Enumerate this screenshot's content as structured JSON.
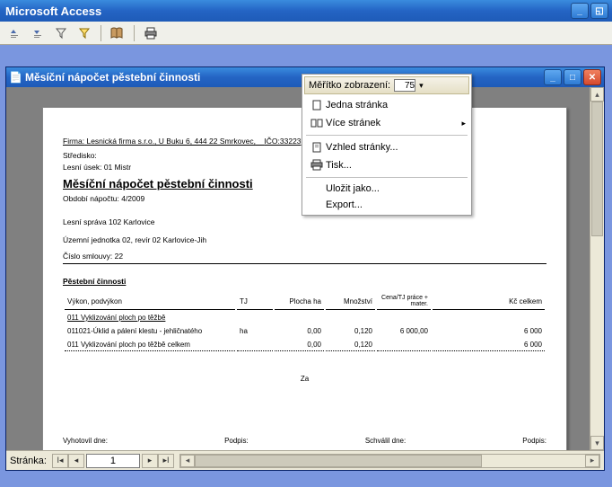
{
  "app": {
    "title": "Microsoft Access"
  },
  "docwin": {
    "title": "Měsíční nápočet pěstební činnosti"
  },
  "report": {
    "firm_label": "Firma:",
    "firm": "Lesnická firma s.r.o., U Buku 6, 444 22 Smrkovec,",
    "ico_label": "IČO:33223",
    "stredisko_label": "Středisko:",
    "lesni_usek": "Lesní úsek: 01 Mistr",
    "title": "Měsíční nápočet pěstební činnosti",
    "obdobi": "Období nápočtu:  4/2009",
    "sprava": "Lesní správa 102 Karlovice",
    "jednotka": "Územní jednotka 02, revír 02 Karlovice-Jih",
    "smlouva": "Číslo smlouvy:   22",
    "section": "Pěstební činnosti",
    "headers": {
      "vykon": "Výkon, podvýkon",
      "tj": "TJ",
      "plocha": "Plocha ha",
      "mnozstvi": "Množství",
      "cena": "Cena/TJ práce + mater.",
      "kc": "Kč celkem"
    },
    "rows": [
      {
        "label": "011  Vyklizování ploch po těžbě",
        "sub": true
      },
      {
        "label": "011021-Úklid a pálení klestu - jehličnatého",
        "tj": "ha",
        "plocha": "0,00",
        "mnoz": "0,120",
        "cena": "6 000,00",
        "kc": "6 000"
      },
      {
        "label": "011 Vyklizování ploch po těžbě celkem",
        "tj": "",
        "plocha": "0,00",
        "mnoz": "0,120",
        "cena": "",
        "kc": "6 000",
        "dot": true
      }
    ],
    "za": "Za",
    "sign": {
      "vyhotovil": "Vyhotovil dne:",
      "podpis": "Podpis:",
      "schvalil": "Schválil dne:",
      "podpis2": "Podpis:"
    }
  },
  "footer": {
    "page_label": "Stránka:",
    "page": "1"
  },
  "menu": {
    "scale_label": "Měřítko zobrazení:",
    "scale_value": "75",
    "items": [
      {
        "key": "one_page",
        "label": "Jedna stránka"
      },
      {
        "key": "more_pages",
        "label": "Více stránek",
        "arrow": true
      },
      {
        "key": "page_setup",
        "label": "Vzhled stránky..."
      },
      {
        "key": "print",
        "label": "Tisk..."
      },
      {
        "key": "save_as",
        "label": "Uložit jako..."
      },
      {
        "key": "export",
        "label": "Export..."
      }
    ]
  }
}
